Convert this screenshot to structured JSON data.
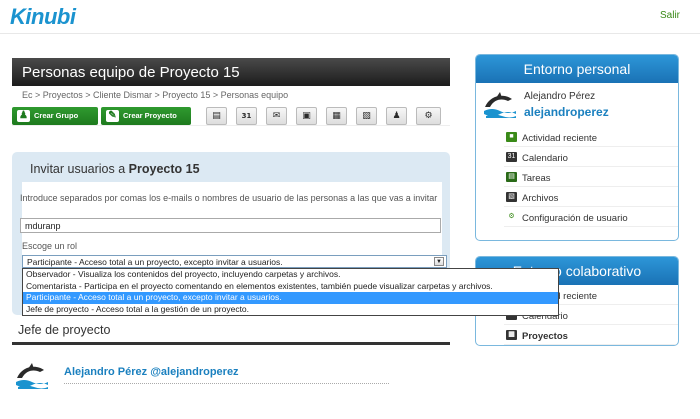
{
  "app": {
    "logo": "Kinubi",
    "logout": "Salir"
  },
  "page": {
    "title": "Personas equipo de Proyecto 15",
    "breadcrumb": "Ec > Proyectos > Cliente Dismar > Proyecto 15 > Personas equipo"
  },
  "toolbar": {
    "create_group": "Crear Grupo",
    "create_project": "Crear Proyecto",
    "icons": [
      "notes-icon",
      "calendar-icon",
      "chat-icon",
      "document-icon",
      "board-icon",
      "folder-icon",
      "people-icon",
      "settings-icon"
    ],
    "calendar_number": "31"
  },
  "invite": {
    "title_prefix": "Invitar usuarios a",
    "title_project": "Proyecto 15",
    "help": "Introduce separados por comas los e-mails o nombres de usuario de las personas a las que vas a invitar",
    "input_value": "mduranp",
    "role_label": "Escoge un rol",
    "selected_role": "Participante - Acceso total a un proyecto, excepto invitar a usuarios.",
    "options": [
      "Observador - Visualiza los contenidos del proyecto, incluyendo carpetas y archivos.",
      "Comentarista - Participa en el proyecto comentando en elementos existentes, también puede visualizar carpetas y archivos.",
      "Participante - Acceso total a un proyecto, excepto invitar a usuarios.",
      "Jefe de proyecto - Acceso total a la gestión de un proyecto."
    ]
  },
  "jefe": {
    "heading": "Jefe de proyecto",
    "name": "Alejandro Pérez @alejandroperez"
  },
  "personal": {
    "title": "Entorno personal",
    "user_name": "Alejandro Pérez",
    "username": "alejandroperez",
    "items": [
      "Actividad reciente",
      "Calendario",
      "Tareas",
      "Archivos",
      "Configuración de usuario"
    ]
  },
  "collab": {
    "title": "Entorno colaborativo",
    "items": [
      "Actividad reciente",
      "Calendario",
      "Proyectos"
    ]
  },
  "colors": {
    "accent": "#1b80bf",
    "green": "#2a8a2a",
    "selected": "#3399ff",
    "header": "#2d96d8"
  }
}
